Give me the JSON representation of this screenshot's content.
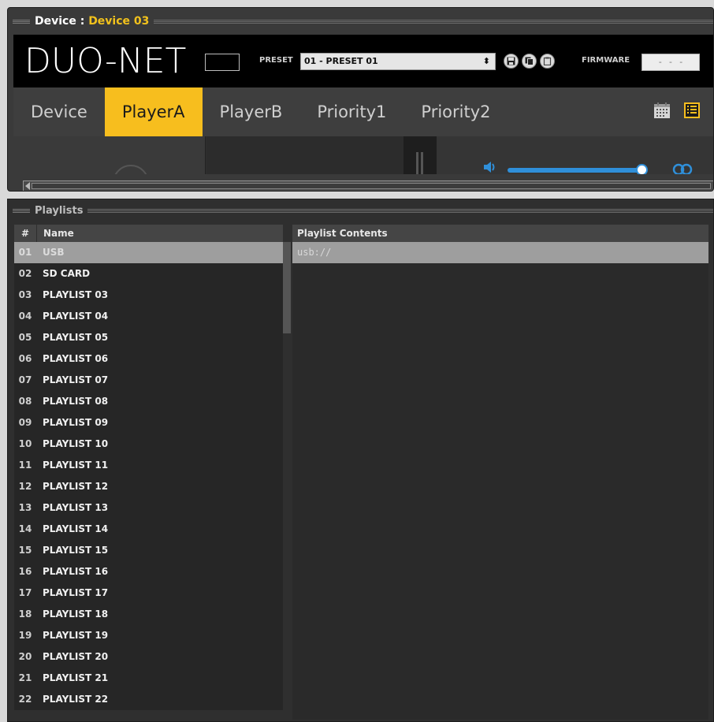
{
  "device_panel": {
    "title_prefix": "Device : ",
    "device_name": "Device 03",
    "logo": "DUO-NET",
    "preset_label": "PRESET",
    "preset_value": "01 - PRESET 01",
    "firmware_label": "FIRMWARE",
    "firmware_value": "- - -",
    "tabs": [
      {
        "label": "Device",
        "active": false
      },
      {
        "label": "PlayerA",
        "active": true
      },
      {
        "label": "PlayerB",
        "active": false
      },
      {
        "label": "Priority1",
        "active": false
      },
      {
        "label": "Priority2",
        "active": false
      }
    ],
    "tab_icons": [
      "calendar-icon",
      "list-icon"
    ],
    "volume_level": 0.97,
    "colors": {
      "accent": "#f7be1e",
      "slider": "#2f8fd9"
    }
  },
  "playlists_panel": {
    "title": "Playlists",
    "col_num": "#",
    "col_name": "Name",
    "col_contents": "Playlist Contents",
    "selected_index": 0,
    "contents": [
      "usb://"
    ],
    "rows": [
      {
        "num": "01",
        "name": "USB"
      },
      {
        "num": "02",
        "name": "SD CARD"
      },
      {
        "num": "03",
        "name": "PLAYLIST 03"
      },
      {
        "num": "04",
        "name": "PLAYLIST 04"
      },
      {
        "num": "05",
        "name": "PLAYLIST 05"
      },
      {
        "num": "06",
        "name": "PLAYLIST 06"
      },
      {
        "num": "07",
        "name": "PLAYLIST 07"
      },
      {
        "num": "08",
        "name": "PLAYLIST 08"
      },
      {
        "num": "09",
        "name": "PLAYLIST 09"
      },
      {
        "num": "10",
        "name": "PLAYLIST 10"
      },
      {
        "num": "11",
        "name": "PLAYLIST 11"
      },
      {
        "num": "12",
        "name": "PLAYLIST 12"
      },
      {
        "num": "13",
        "name": "PLAYLIST 13"
      },
      {
        "num": "14",
        "name": "PLAYLIST 14"
      },
      {
        "num": "15",
        "name": "PLAYLIST 15"
      },
      {
        "num": "16",
        "name": "PLAYLIST 16"
      },
      {
        "num": "17",
        "name": "PLAYLIST 17"
      },
      {
        "num": "18",
        "name": "PLAYLIST 18"
      },
      {
        "num": "19",
        "name": "PLAYLIST 19"
      },
      {
        "num": "20",
        "name": "PLAYLIST 20"
      },
      {
        "num": "21",
        "name": "PLAYLIST 21"
      },
      {
        "num": "22",
        "name": "PLAYLIST 22"
      }
    ]
  }
}
